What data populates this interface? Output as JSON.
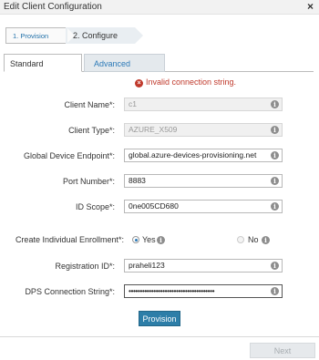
{
  "window": {
    "title": "Edit Client Configuration",
    "close_icon": "×"
  },
  "steps": [
    {
      "label": "1. Provision"
    },
    {
      "label": "2. Configure"
    }
  ],
  "tabs": [
    {
      "label": "Standard"
    },
    {
      "label": "Advanced"
    }
  ],
  "error": {
    "message": "Invalid connection string.",
    "icon": "×"
  },
  "fields": {
    "client_name": {
      "label": "Client Name*:",
      "value": "c1"
    },
    "client_type": {
      "label": "Client Type*:",
      "value": "AZURE_X509"
    },
    "global_endpoint": {
      "label": "Global Device Endpoint*:",
      "value": "global.azure-devices-provisioning.net"
    },
    "port_number": {
      "label": "Port Number*:",
      "value": "8883"
    },
    "id_scope": {
      "label": "ID Scope*:",
      "value": "0ne005CD680"
    },
    "individual_enrollment": {
      "label": "Create Individual Enrollment*:",
      "yes_label": "Yes",
      "no_label": "No",
      "selected": "Yes"
    },
    "registration_id": {
      "label": "Registration ID*:",
      "value": "praheli123"
    },
    "dps_connection_string": {
      "label": "DPS Connection String*:",
      "value": "••••••••••••••••••••••••••••••••••••••"
    }
  },
  "info_icon": "i",
  "buttons": {
    "provision": "Provision",
    "next": "Next"
  },
  "colors": {
    "accent": "#2d7ea8",
    "error": "#c0392b",
    "tab_link": "#2c7ab8"
  }
}
